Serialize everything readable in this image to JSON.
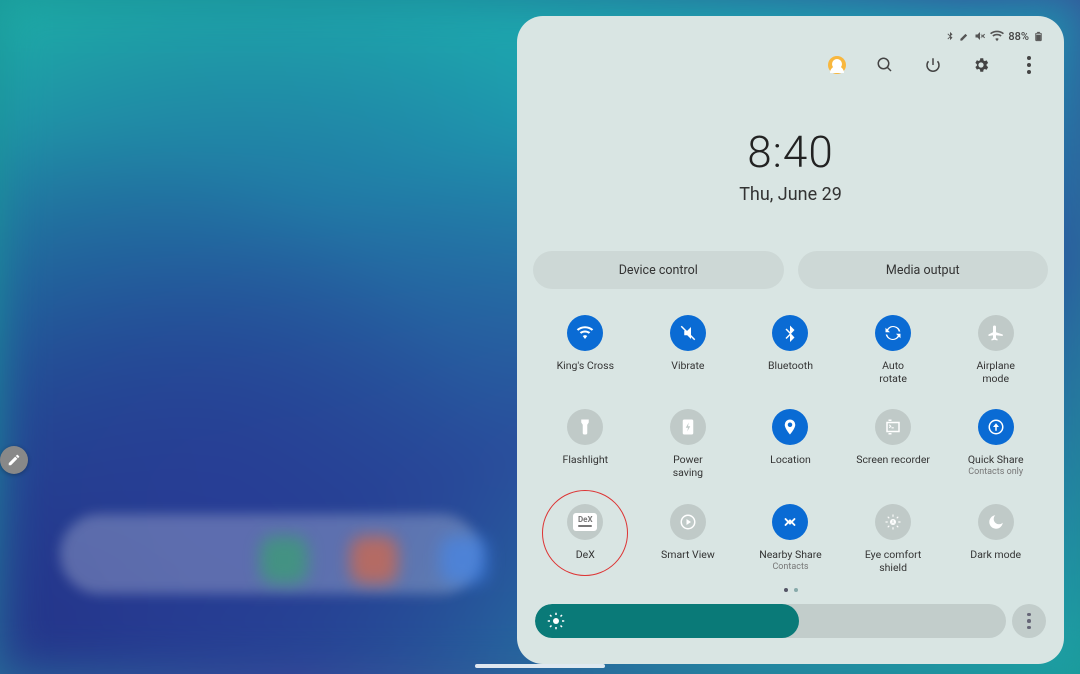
{
  "status_bar": {
    "battery_percent": "88%"
  },
  "clock": {
    "time": "8:40",
    "date": "Thu, June 29"
  },
  "pills": {
    "device_control": "Device control",
    "media_output": "Media output"
  },
  "tiles": [
    {
      "id": "wifi",
      "label": "King's Cross",
      "sub": "",
      "on": true
    },
    {
      "id": "vibrate",
      "label": "Vibrate",
      "sub": "",
      "on": true
    },
    {
      "id": "bluetooth",
      "label": "Bluetooth",
      "sub": "",
      "on": true
    },
    {
      "id": "autorotate",
      "label": "Auto\nrotate",
      "sub": "",
      "on": true
    },
    {
      "id": "airplane",
      "label": "Airplane\nmode",
      "sub": "",
      "on": false
    },
    {
      "id": "flashlight",
      "label": "Flashlight",
      "sub": "",
      "on": false
    },
    {
      "id": "powersaving",
      "label": "Power\nsaving",
      "sub": "",
      "on": false
    },
    {
      "id": "location",
      "label": "Location",
      "sub": "",
      "on": true
    },
    {
      "id": "screenrec",
      "label": "Screen recorder",
      "sub": "",
      "on": false
    },
    {
      "id": "quickshare",
      "label": "Quick Share",
      "sub": "Contacts only",
      "on": true
    },
    {
      "id": "dex",
      "label": "DeX",
      "sub": "",
      "on": false,
      "highlight": true
    },
    {
      "id": "smartview",
      "label": "Smart View",
      "sub": "",
      "on": false
    },
    {
      "id": "nearbyshare",
      "label": "Nearby Share",
      "sub": "Contacts",
      "on": true
    },
    {
      "id": "eyecomfort",
      "label": "Eye comfort\nshield",
      "sub": "",
      "on": false
    },
    {
      "id": "darkmode",
      "label": "Dark mode",
      "sub": "",
      "on": false
    }
  ],
  "brightness": {
    "percent": 56
  }
}
